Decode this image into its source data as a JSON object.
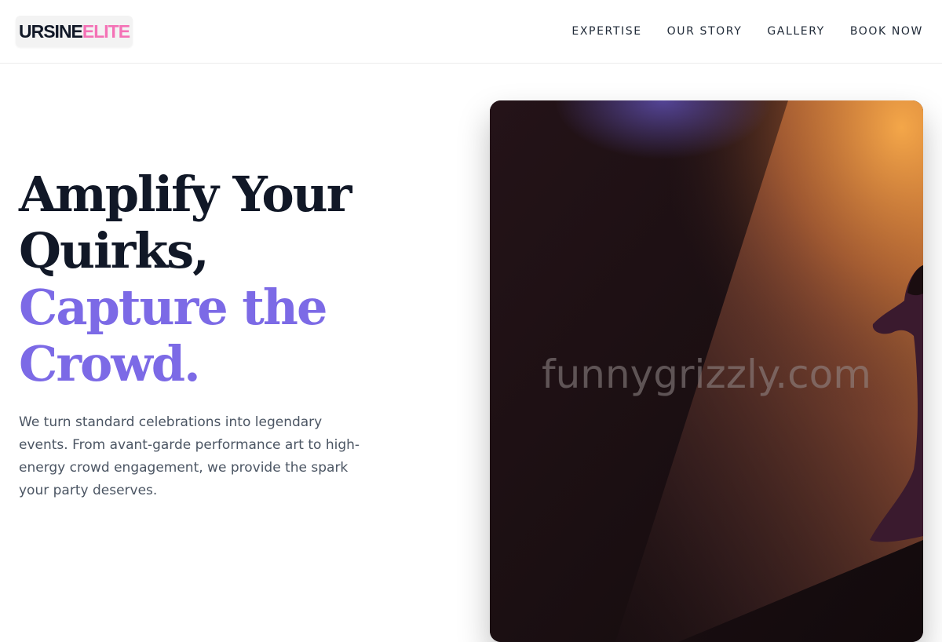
{
  "brand": {
    "name_part1": "URSINE",
    "name_part2": "ELITE"
  },
  "nav": {
    "items": [
      {
        "label": "EXPERTISE"
      },
      {
        "label": "OUR STORY"
      },
      {
        "label": "GALLERY"
      },
      {
        "label": "BOOK NOW"
      }
    ]
  },
  "hero": {
    "title_line1": "Amplify Your",
    "title_line2": "Quirks,",
    "title_line3": "Capture the",
    "title_line4": "Crowd.",
    "description": "We turn standard celebrations into legendary events. From avant-garde performance art to high-energy crowd engagement, we provide the spark your party deserves.",
    "image_watermark": "funnygrizzly.com"
  },
  "colors": {
    "accent": "#7c6ae6",
    "brand_pink": "#f472b6",
    "heading": "#111827",
    "body_text": "#4b5563"
  }
}
